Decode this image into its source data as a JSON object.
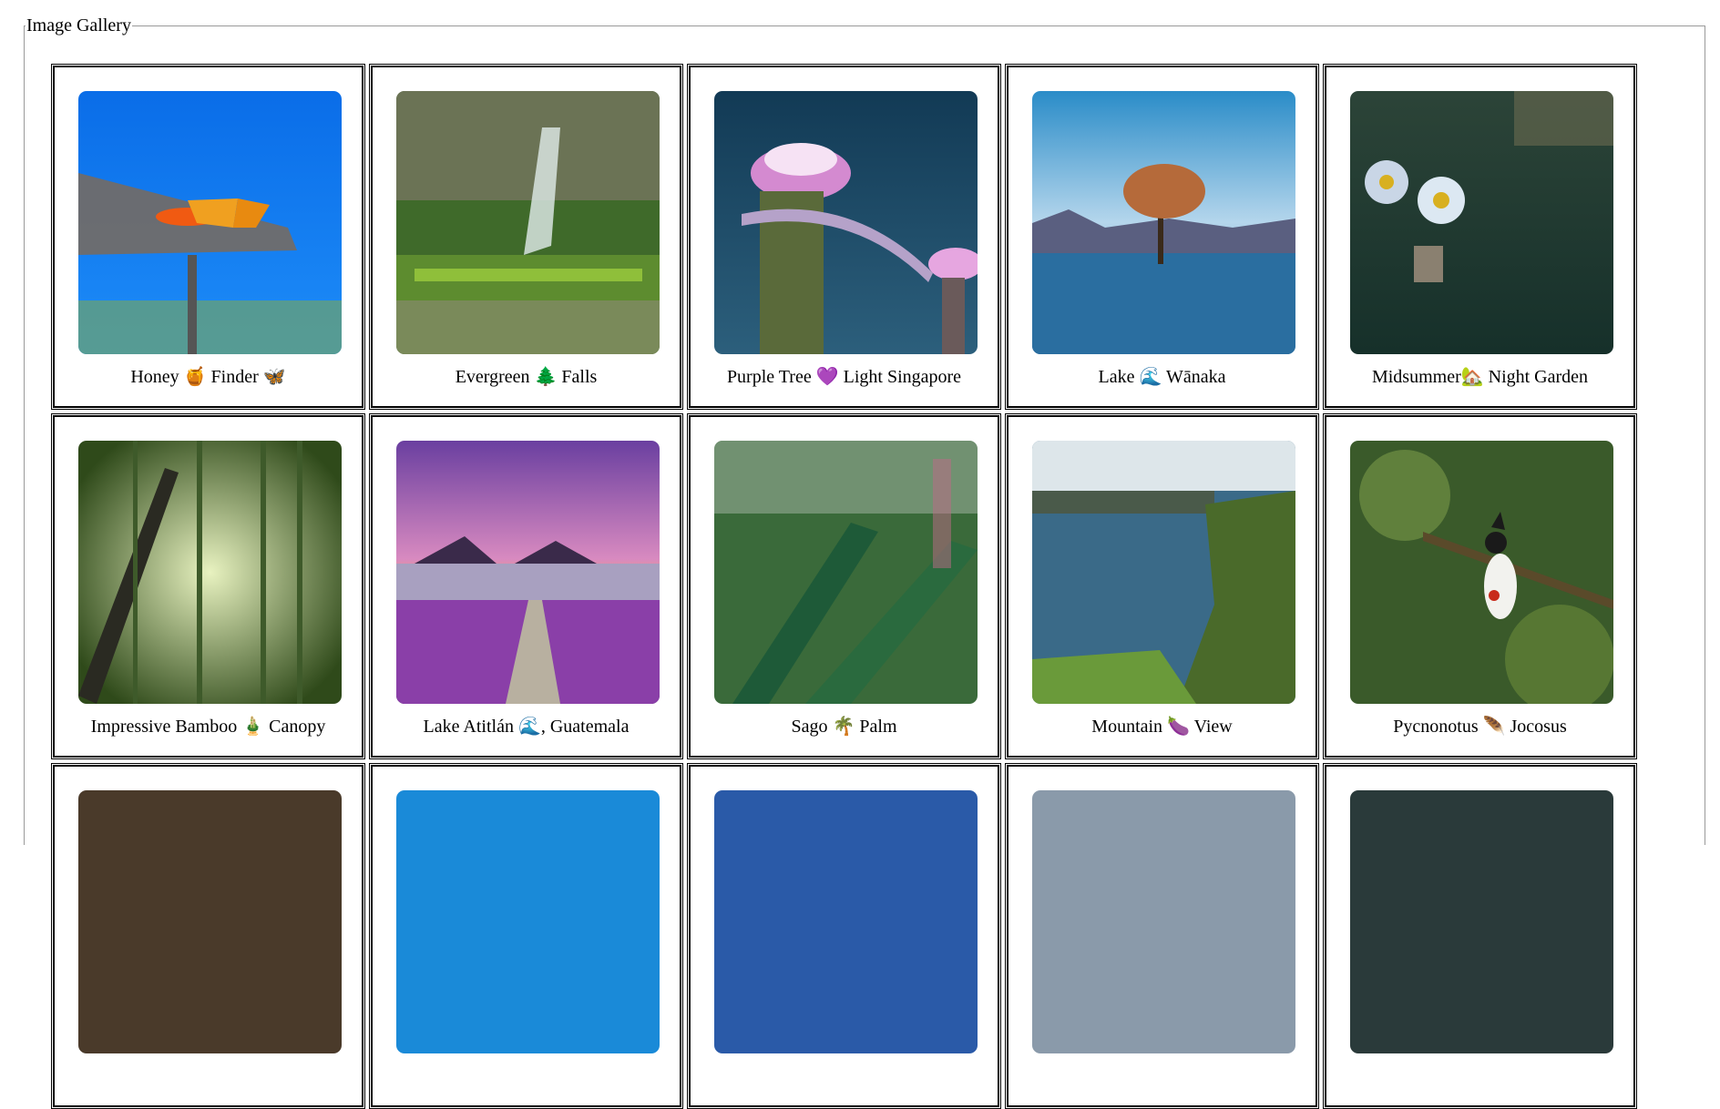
{
  "gallery": {
    "legend": "Image Gallery",
    "items": [
      {
        "caption": "Honey 🍯 Finder 🦋",
        "icon": "honey-pot-icon"
      },
      {
        "caption": "Evergreen 🌲 Falls",
        "icon": "evergreen-tree-icon"
      },
      {
        "caption": "Purple Tree 💜 Light Singapore",
        "icon": "purple-heart-icon"
      },
      {
        "caption": "Lake 🌊 Wānaka",
        "icon": "wave-icon"
      },
      {
        "caption": "Midsummer🏡 Night Garden",
        "icon": "house-garden-icon"
      },
      {
        "caption": "Impressive Bamboo 🎍 Canopy",
        "icon": "bamboo-icon"
      },
      {
        "caption": "Lake Atitlán 🌊, Guatemala",
        "icon": "wave-icon"
      },
      {
        "caption": "Sago 🌴 Palm",
        "icon": "palm-tree-icon"
      },
      {
        "caption": "Mountain 🍆 View",
        "icon": "eggplant-icon"
      },
      {
        "caption": "Pycnonotus 🪶 Jocosus",
        "icon": "feather-icon"
      },
      {
        "caption": "",
        "icon": ""
      },
      {
        "caption": "",
        "icon": ""
      },
      {
        "caption": "",
        "icon": ""
      },
      {
        "caption": "",
        "icon": ""
      },
      {
        "caption": "",
        "icon": ""
      }
    ]
  },
  "colors": {
    "border": "#000000",
    "fieldset_border": "#9a9a9a",
    "background": "#ffffff"
  }
}
